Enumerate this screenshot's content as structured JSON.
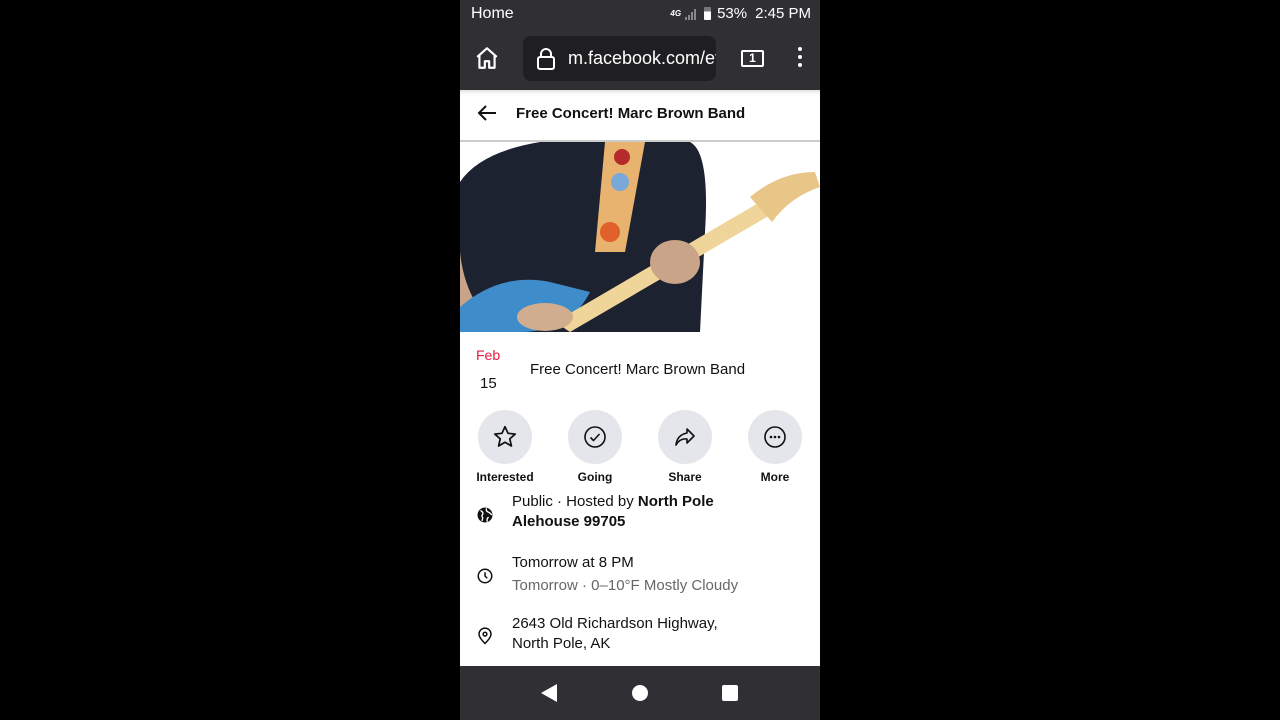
{
  "status_bar": {
    "left_label": "Home",
    "network": "4G",
    "battery": "53%",
    "time": "2:45 PM"
  },
  "browser": {
    "url": "m.facebook.com/ev",
    "tab_count": "1",
    "icons": [
      "home-icon",
      "lock-icon",
      "tabs-icon",
      "menu-icon"
    ]
  },
  "header": {
    "title": "Free Concert! Marc Brown Band",
    "back_icon": "arrow-left-icon"
  },
  "event": {
    "month": "Feb",
    "day": "15",
    "title": "Free Concert! Marc Brown Band",
    "accent_color": "#e41e3f"
  },
  "actions": [
    {
      "label": "Interested",
      "icon": "star-icon"
    },
    {
      "label": "Going",
      "icon": "check-circle-icon"
    },
    {
      "label": "Share",
      "icon": "share-icon"
    },
    {
      "label": "More",
      "icon": "more-icon"
    }
  ],
  "info": {
    "privacy_prefix": "Public · Hosted by ",
    "host": "North Pole Alehouse 99705",
    "time": "Tomorrow at 8 PM",
    "weather": "Tomorrow · 0–10°F Mostly Cloudy",
    "address_line1": "2643 Old Richardson Highway,",
    "address_line2": "North Pole, AK"
  },
  "nav_bar": {
    "icons": [
      "nav-back-icon",
      "nav-home-icon",
      "nav-recents-icon"
    ]
  }
}
